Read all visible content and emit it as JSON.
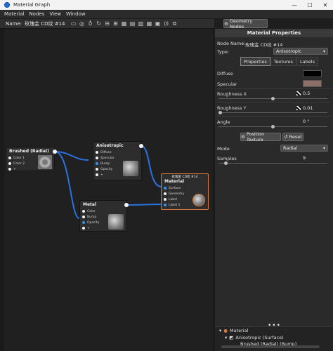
{
  "window": {
    "title": "Material Graph",
    "min": "—",
    "max": "☐",
    "close": "✕"
  },
  "menu": [
    "Material",
    "Nodes",
    "View",
    "Window"
  ],
  "toolbar": {
    "name_label": "Name:",
    "name_value": "玫瑰金 CD纹 #14",
    "geometry_button": "Geometry Nodes"
  },
  "nodes": {
    "brushed": {
      "title": "Brushed (Radial)",
      "inputs": [
        "Color 1",
        "Color 2",
        "+"
      ]
    },
    "anisotropic": {
      "title": "Anisotropic",
      "inputs": [
        "Diffuse",
        "Specular",
        "Bump",
        "Opacity",
        "+"
      ]
    },
    "metal": {
      "title": "Metal",
      "inputs": [
        "Color",
        "Bump",
        "Opacity",
        "+"
      ]
    },
    "material": {
      "header": "玫瑰金 CD纹 #14",
      "title": "Material",
      "inputs": [
        "Surface",
        "Geometry",
        "Label",
        "Label 1"
      ]
    }
  },
  "panel": {
    "header": "Material Properties",
    "node_name_label": "Node Name:",
    "node_name_value": "玫瑰金 CD纹 #14",
    "type_label": "Type:",
    "type_value": "Anisotropic",
    "tabs": [
      "Properties",
      "Textures",
      "Labels"
    ],
    "diffuse_label": "Diffuse",
    "specular_label": "Specular",
    "roughness_x_label": "Roughness X",
    "roughness_x_value": "0.5",
    "roughness_y_label": "Roughness Y",
    "roughness_y_value": "0.01",
    "angle_label": "Angle",
    "angle_value": "0 °",
    "position_texture_button": "Position Texture",
    "reset_button": "Reset",
    "mode_label": "Mode",
    "mode_value": "Radial",
    "samples_label": "Samples",
    "samples_value": "9",
    "more": "•••",
    "colors": {
      "diffuse": "#000000",
      "specular": "#8c6f69"
    }
  },
  "tree": {
    "root": "Material",
    "child": "Anisotropic (Surface)",
    "grandchild": "Brushed (Radial) (Bump)"
  }
}
